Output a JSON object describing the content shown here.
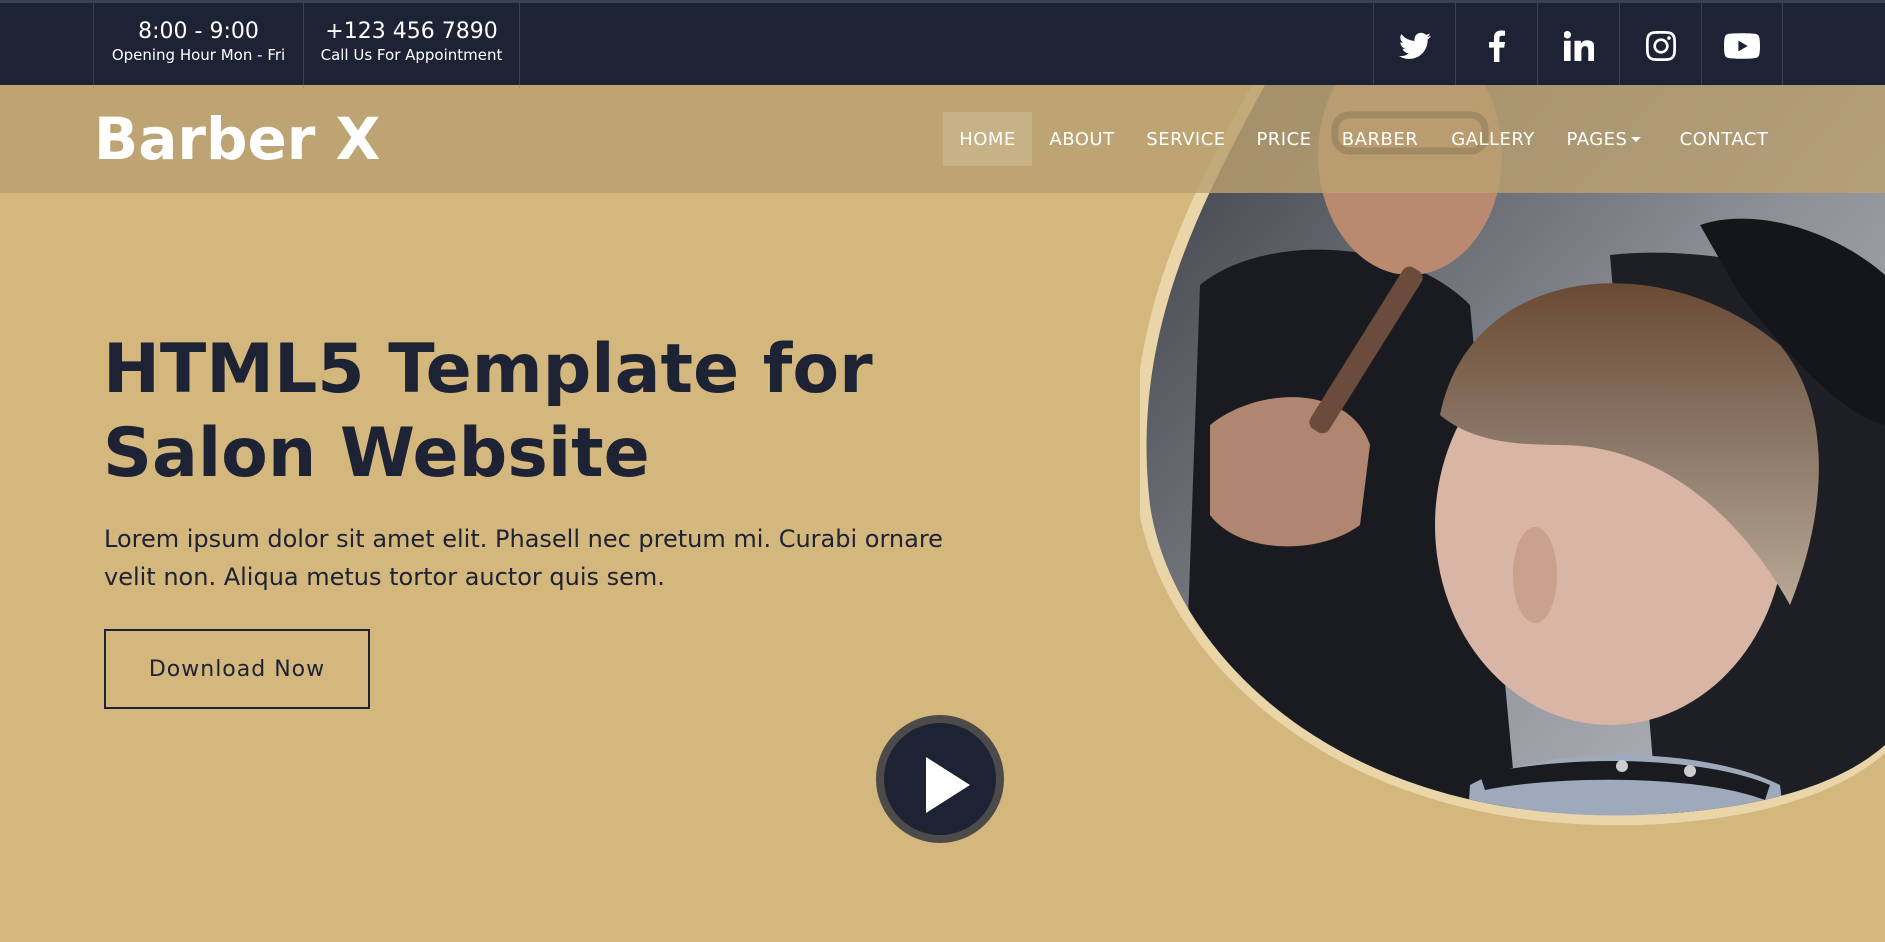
{
  "topbar": {
    "hours": {
      "value": "8:00 - 9:00",
      "label": "Opening Hour Mon - Fri"
    },
    "phone": {
      "value": "+123 456 7890",
      "label": "Call Us For Appointment"
    },
    "social": [
      {
        "name": "twitter-icon"
      },
      {
        "name": "facebook-icon"
      },
      {
        "name": "linkedin-icon"
      },
      {
        "name": "instagram-icon"
      },
      {
        "name": "youtube-icon"
      }
    ]
  },
  "navbar": {
    "brand": "Barber X",
    "items": [
      {
        "label": "HOME",
        "active": true
      },
      {
        "label": "ABOUT"
      },
      {
        "label": "SERVICE"
      },
      {
        "label": "PRICE"
      },
      {
        "label": "BARBER"
      },
      {
        "label": "GALLERY"
      },
      {
        "label": "PAGES",
        "dropdown": true
      },
      {
        "label": "CONTACT"
      }
    ]
  },
  "hero": {
    "title_line1": "HTML5 Template for",
    "title_line2": "Salon Website",
    "description_line1": "Lorem ipsum dolor sit amet elit. Phasell nec pretum mi. Curabi ornare",
    "description_line2": "velit non. Aliqua metus tortor auctor quis sem.",
    "cta": "Download Now"
  },
  "colors": {
    "dark": "#1d2234",
    "gold": "#d4b77c",
    "navbar": "#b9a070"
  }
}
